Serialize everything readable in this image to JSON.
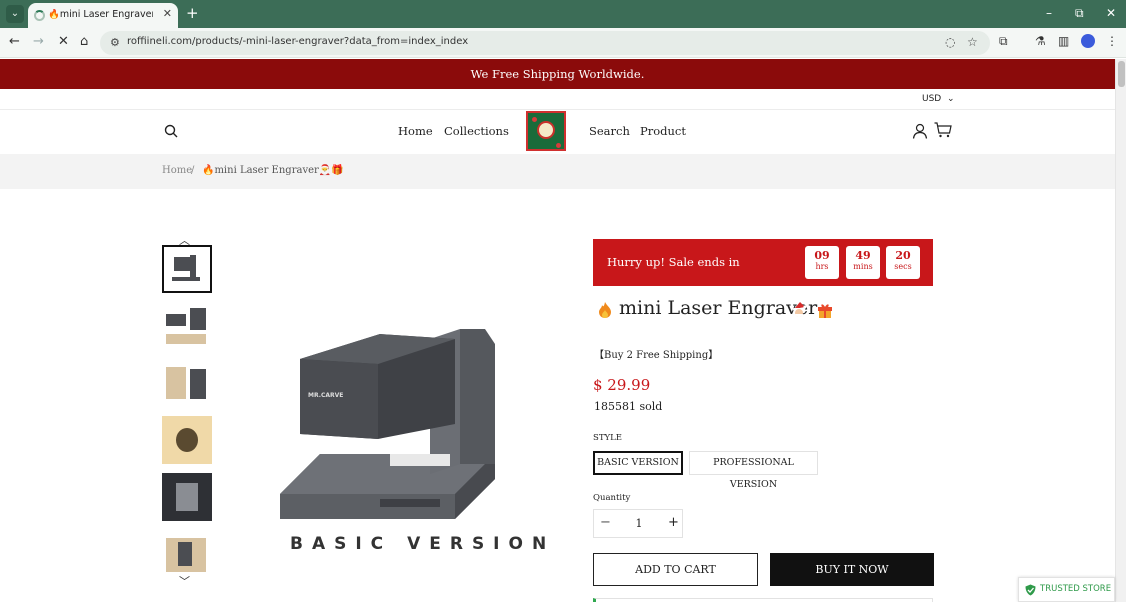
{
  "browser": {
    "tab_title": "🔥mini Laser Engraver🎅🎁",
    "tab_close": "✕",
    "new_tab": "+",
    "url": "roffiineli.com/products/-mini-laser-engraver?data_from=index_index",
    "window_controls": {
      "minimize": "–",
      "maximize": "⧉",
      "close": "✕"
    }
  },
  "site": {
    "announcement": "We Free Shipping Worldwide.",
    "currency": "USD",
    "nav": [
      "Home",
      "Collections",
      "Search",
      "Product"
    ]
  },
  "breadcrumb": {
    "home": "Home",
    "separator": "/",
    "current": "🔥mini Laser Engraver🎅🎁"
  },
  "gallery": {
    "main_caption": "BASIC VERSION",
    "thumbnail_count": 6,
    "selected_index": 0
  },
  "product": {
    "sale_text": "Hurry up!  Sale ends in",
    "timer": [
      {
        "value": "09",
        "unit": "hrs"
      },
      {
        "value": "49",
        "unit": "mins"
      },
      {
        "value": "20",
        "unit": "secs"
      }
    ],
    "title": "mini Laser Engraver",
    "promo": "【Buy 2 Free Shipping】",
    "price": "$ 29.99",
    "sold": "185581 sold",
    "style_label": "STYLE",
    "variants": [
      "BASIC VERSION",
      "PROFESSIONAL VERSION"
    ],
    "selected_variant": "BASIC VERSION",
    "quantity_label": "Quantity",
    "quantity": "1",
    "add_to_cart": "ADD TO CART",
    "buy_now": "BUY IT NOW"
  },
  "badge": {
    "trusted": "TRUSTED STORE"
  },
  "colors": {
    "announcement_bg": "#8b0b0b",
    "sale_bg": "#c8171a",
    "price": "#c8171a",
    "chrome_frame": "#3c6d57",
    "trusted_green": "#2f9a4a"
  }
}
